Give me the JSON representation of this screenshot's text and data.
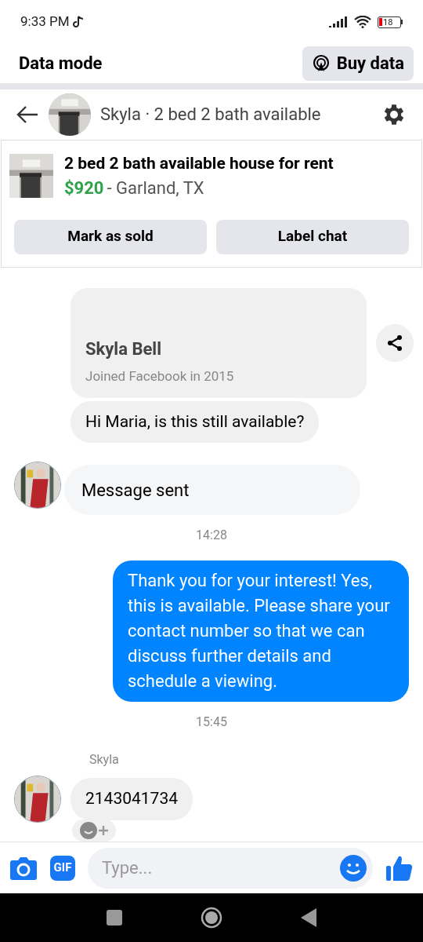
{
  "status_bar": {
    "time": "9:33 PM",
    "battery": "18"
  },
  "data_bar": {
    "title": "Data mode",
    "button": "Buy data"
  },
  "header": {
    "title": "Skyla · 2 bed 2 bath available"
  },
  "listing": {
    "title": "2 bed 2 bath available house for rent",
    "price": "$920",
    "location": "- Garland, TX",
    "actions": [
      "Mark as sold",
      "Label chat"
    ]
  },
  "messages": [
    {
      "kind": "profile",
      "name": "Skyla Bell",
      "subtitle": "Joined Facebook in 2015"
    },
    {
      "kind": "incoming",
      "text": "Hi Maria, is this still available?"
    },
    {
      "kind": "notice",
      "text": "Message sent",
      "avatar": true
    },
    {
      "kind": "time",
      "text": "14:28"
    },
    {
      "kind": "outgoing",
      "text": "Thank you for your interest! Yes, this is available. Please share your contact number so that we can discuss further details and schedule a viewing."
    },
    {
      "kind": "time",
      "text": "15:45"
    },
    {
      "kind": "sender",
      "text": "Skyla"
    },
    {
      "kind": "incoming",
      "text": "2143041734",
      "avatar": true,
      "reaction": true
    }
  ],
  "composer": {
    "gif": "GIF",
    "placeholder": "Type..."
  }
}
